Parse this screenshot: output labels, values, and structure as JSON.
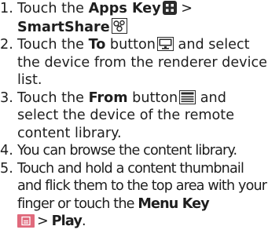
{
  "steps": [
    {
      "num": "1.",
      "p1": "Touch the ",
      "b1": "Apps Key",
      "p2": " > ",
      "b2": "SmartShare",
      "icon1": "apps-grid-icon",
      "icon2": "smartshare-icon"
    },
    {
      "num": "2.",
      "p1": "Touch the ",
      "b1": "To",
      "p2": " button",
      "p3": " and select the device from the renderer device list.",
      "icon1": "monitor-icon"
    },
    {
      "num": "3.",
      "p1": "Touch the ",
      "b1": "From",
      "p2": " button",
      "p3": " and select the device of the remote content library.",
      "icon1": "list-window-icon"
    },
    {
      "num": "4.",
      "p1": "You can browse the content library."
    },
    {
      "num": "5.",
      "p1": "Touch and hold a content thumbnail and flick them to the top area with your finger or touch the ",
      "b1": "Menu Key",
      "p2": "> ",
      "b2": "Play",
      "p3": ".",
      "icon1": "menu-key-icon"
    }
  ],
  "colors": {
    "text": "#1e1e1e",
    "icon_dark": "#2b2b2b",
    "menu_key": "#e06a7c"
  }
}
